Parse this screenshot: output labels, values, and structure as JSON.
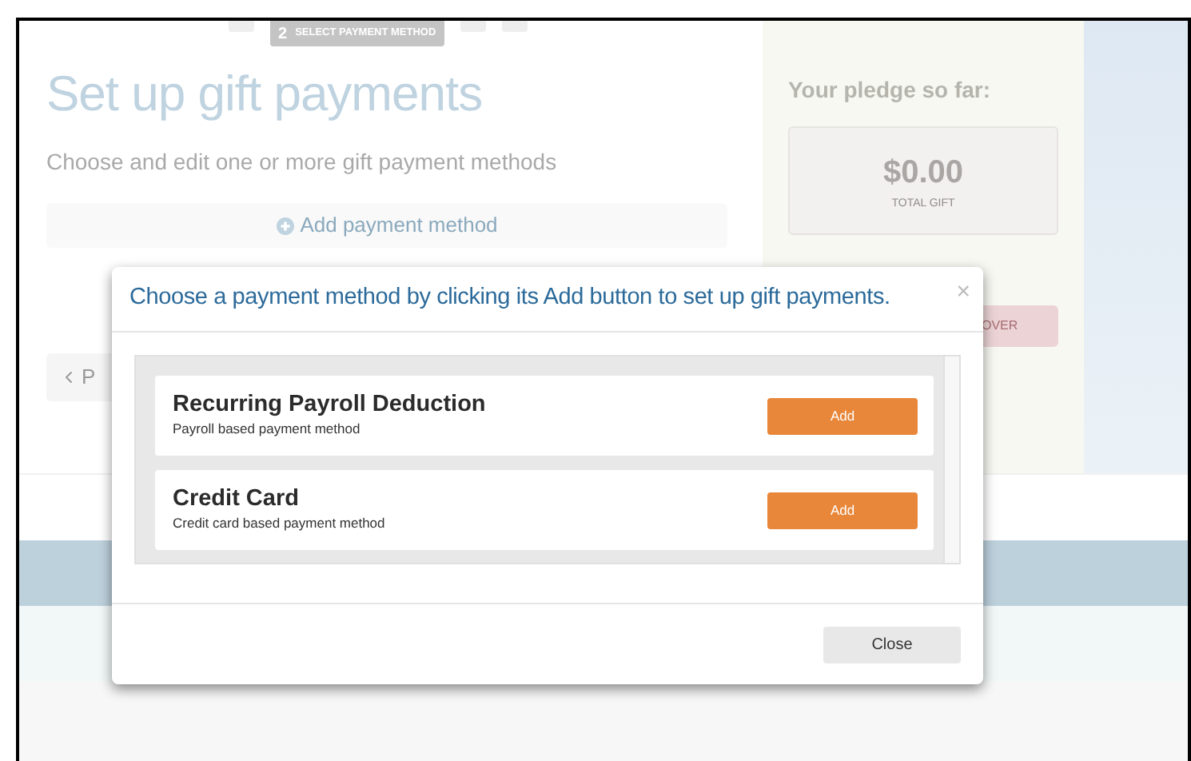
{
  "steps": [
    {
      "selected": false
    },
    {
      "selected": true,
      "number": "2",
      "label": "SELECT PAYMENT METHOD"
    },
    {
      "selected": false
    },
    {
      "selected": false
    }
  ],
  "page": {
    "title": "Set up gift payments",
    "subtitle": "Choose and edit one or more gift payment methods",
    "add_button": "Add payment method",
    "back_button": "P"
  },
  "pledge": {
    "heading": "Your pledge so far:",
    "amount": "$0.00",
    "caption": "TOTAL GIFT",
    "action_button": "OVER"
  },
  "dialog": {
    "title": "Choose a payment method by clicking its Add button to set up gift payments.",
    "close_icon": "×",
    "methods": [
      {
        "name": "Recurring Payroll Deduction",
        "description": "Payroll based payment method",
        "button": "Add"
      },
      {
        "name": "Credit Card",
        "description": "Credit card based payment method",
        "button": "Add"
      }
    ],
    "footer_button": "Close"
  }
}
